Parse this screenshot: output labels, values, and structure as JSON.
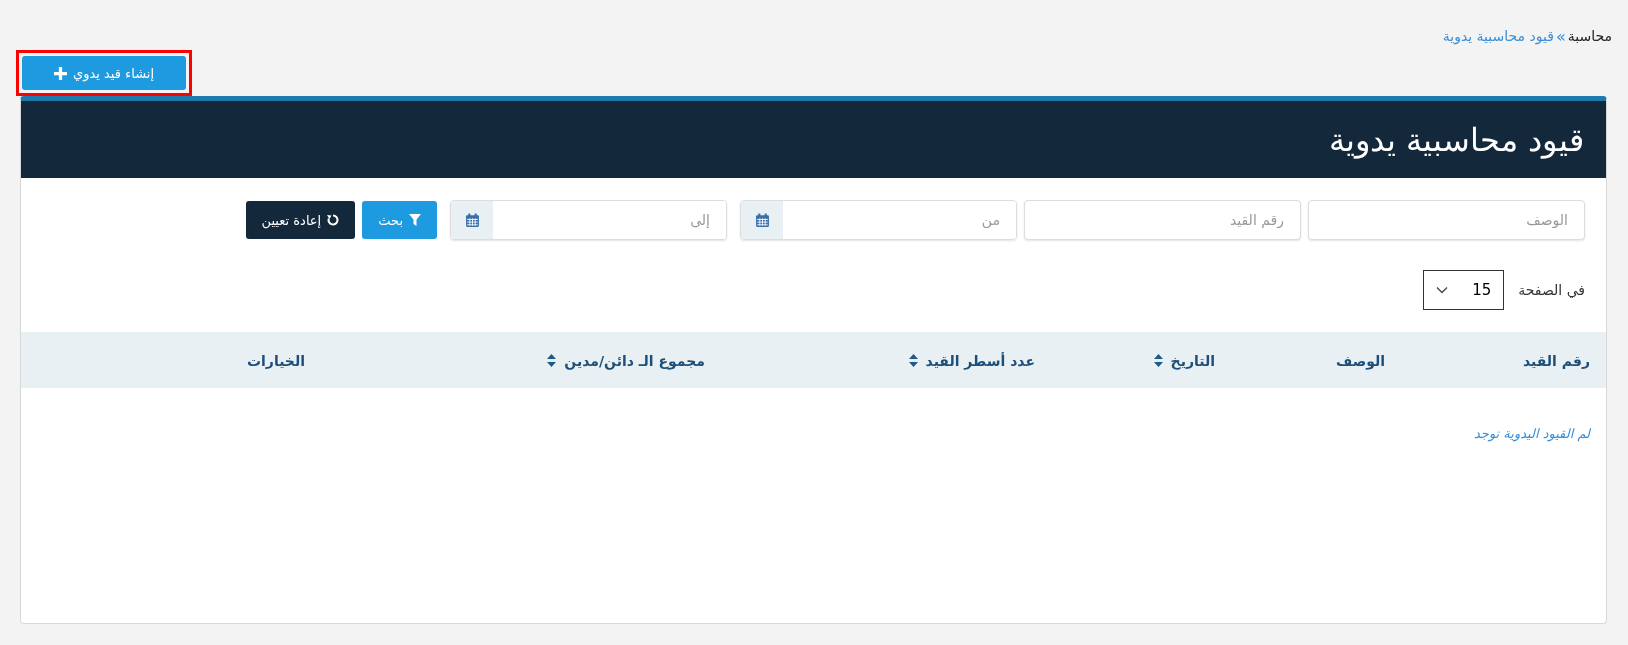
{
  "breadcrumb": [
    {
      "label": "محاسبة",
      "link": false
    },
    {
      "label": "قيود محاسبية يدوية",
      "link": true
    }
  ],
  "breadcrumb_separator": "»",
  "create_button": {
    "label": "إنشاء قيد يدوي",
    "highlighted": true
  },
  "panel": {
    "title": "قيود محاسبية يدوية"
  },
  "filters": [
    {
      "kind": "text",
      "placeholder": "الوصف"
    },
    {
      "kind": "text",
      "placeholder": "رقم القيد"
    },
    {
      "kind": "date",
      "placeholder": "من"
    },
    {
      "kind": "date",
      "placeholder": "إلى"
    }
  ],
  "search_button": {
    "label": "بحث"
  },
  "reset_button": {
    "label": "إعادة تعيين"
  },
  "page_size": {
    "label": "في الصفحة",
    "value": "15"
  },
  "table": {
    "columns": [
      {
        "label": "رقم القيد",
        "sortable": false
      },
      {
        "label": "الوصف",
        "sortable": false
      },
      {
        "label": "التاريخ",
        "sortable": true
      },
      {
        "label": "عدد أسطر القيد",
        "sortable": true
      },
      {
        "label": "مجموع الـ دائن/مدين",
        "sortable": true
      },
      {
        "label": "الخيارات",
        "sortable": false
      }
    ],
    "empty_message": "لم القيود اليدوية توجد"
  }
}
